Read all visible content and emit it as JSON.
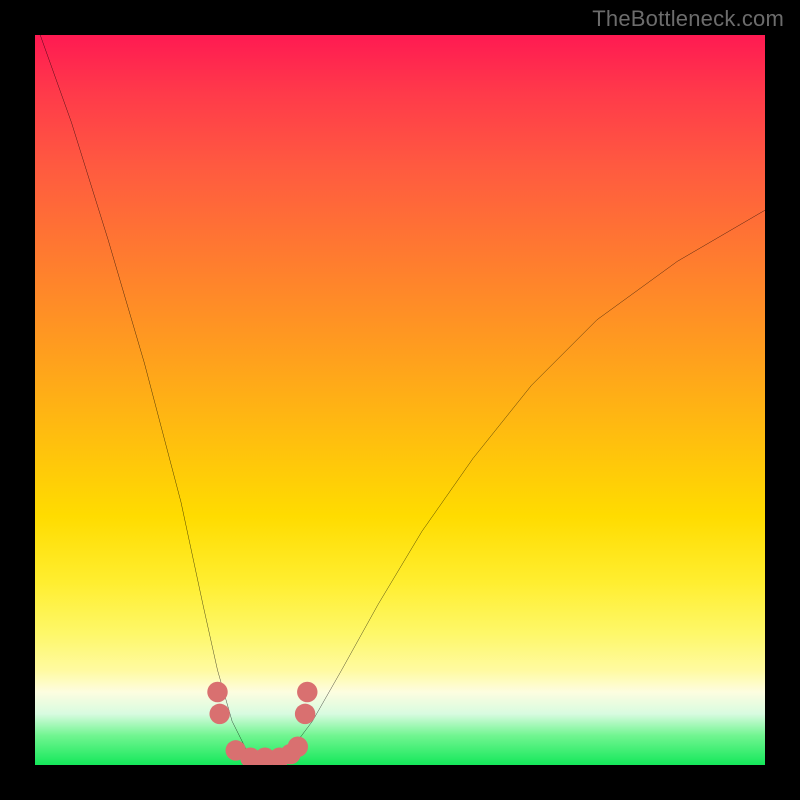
{
  "attribution": "TheBottleneck.com",
  "chart_data": {
    "type": "line",
    "title": "",
    "xlabel": "",
    "ylabel": "",
    "xlim": [
      0,
      100
    ],
    "ylim": [
      0,
      100
    ],
    "series": [
      {
        "name": "bottleneck-curve",
        "x": [
          0,
          5,
          10,
          15,
          20,
          23,
          25,
          27,
          29,
          31,
          33,
          35,
          38,
          42,
          47,
          53,
          60,
          68,
          77,
          88,
          100
        ],
        "y": [
          102,
          88,
          72,
          55,
          36,
          22,
          13,
          6,
          2,
          0,
          0,
          2,
          6,
          13,
          22,
          32,
          42,
          52,
          61,
          69,
          76
        ]
      }
    ],
    "markers": {
      "name": "highlight-points",
      "x": [
        25.0,
        25.3,
        27.5,
        29.5,
        31.5,
        33.5,
        35.0,
        36.0,
        37.0,
        37.3
      ],
      "y": [
        10.0,
        7.0,
        2.0,
        1.0,
        1.0,
        1.0,
        1.5,
        2.5,
        7.0,
        10.0
      ]
    }
  }
}
